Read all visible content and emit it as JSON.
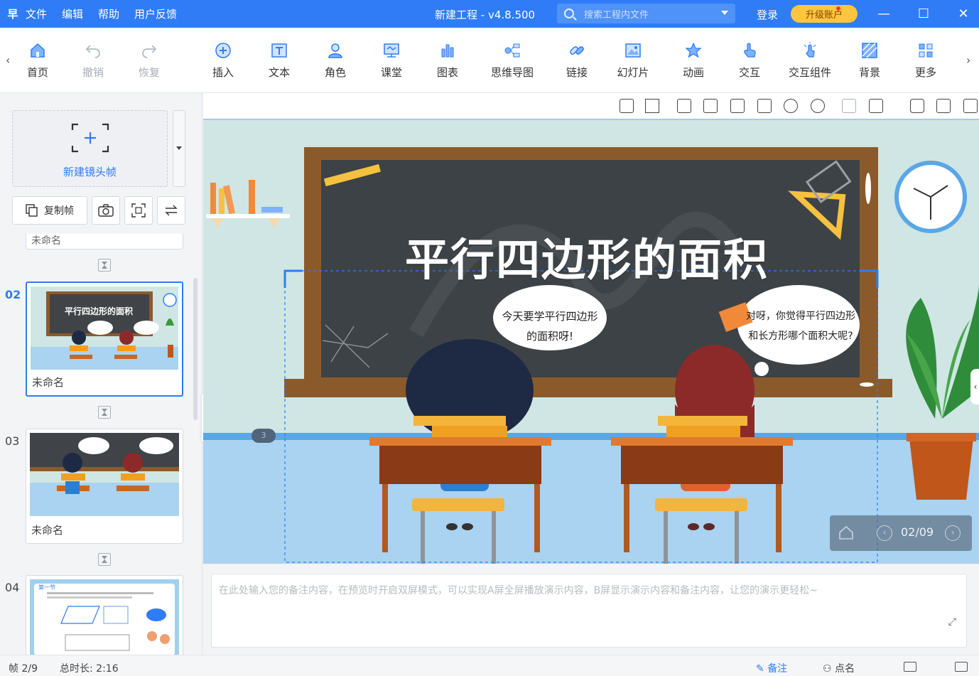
{
  "titlebar": {
    "logo": "早",
    "menu": [
      "文件",
      "编辑",
      "帮助",
      "用户反馈"
    ],
    "title": "新建工程 - v4.8.500",
    "search_placeholder": "搜索工程内文件",
    "login": "登录",
    "upgrade": "升级账户",
    "minimize": "—",
    "maximize": "☐",
    "close": "✕"
  },
  "ribbon": {
    "left_arrow": "‹",
    "right_arrow": "›",
    "tools": [
      {
        "label": "首页",
        "icon": "home-icon"
      },
      {
        "label": "撤销",
        "icon": "undo-icon"
      },
      {
        "label": "恢复",
        "icon": "redo-icon"
      },
      {
        "label": "插入",
        "icon": "plus-circle-icon"
      },
      {
        "label": "文本",
        "icon": "text-icon"
      },
      {
        "label": "角色",
        "icon": "character-icon"
      },
      {
        "label": "课堂",
        "icon": "classroom-icon"
      },
      {
        "label": "图表",
        "icon": "chart-icon"
      },
      {
        "label": "思维导图",
        "icon": "mindmap-icon"
      },
      {
        "label": "链接",
        "icon": "link-icon"
      },
      {
        "label": "幻灯片",
        "icon": "slide-icon"
      },
      {
        "label": "动画",
        "icon": "star-icon"
      },
      {
        "label": "交互",
        "icon": "hand-icon"
      },
      {
        "label": "交互组件",
        "icon": "interact-widget-icon"
      },
      {
        "label": "背景",
        "icon": "background-icon"
      },
      {
        "label": "更多",
        "icon": "more-grid-icon"
      }
    ]
  },
  "leftpanel": {
    "new_frame": "新建镜头帧",
    "copy_frame": "复制帧",
    "cut_label": "未命名",
    "frames": [
      {
        "num": "02",
        "name": "未命名",
        "title": "平行四边形的面积"
      },
      {
        "num": "03",
        "name": "未命名"
      },
      {
        "num": "04",
        "name": ""
      }
    ],
    "thumb4_label": "第一节",
    "collapse": "‹"
  },
  "stage": {
    "title": "平行四边形的面积",
    "bubble_left_line1": "今天要学平行四边形",
    "bubble_left_line2": "的面积呀!",
    "bubble_right_line1": "对呀，你觉得平行四边形",
    "bubble_right_line2": "和长方形哪个面积大呢?",
    "badge": "3",
    "pager_text": "02/09",
    "pager_prev": "‹",
    "pager_next": "›",
    "right_tab": "‹"
  },
  "notes": {
    "placeholder": "在此处输入您的备注内容，在预览时开启双屏模式，可以实现A屏全屏播放演示内容，B屏显示演示内容和备注内容，让您的演示更轻松~",
    "expand": "⤢"
  },
  "status": {
    "frame": "帧 2/9",
    "duration": "总时长: 2:16",
    "notes": "备注",
    "rollcall": "点名"
  }
}
